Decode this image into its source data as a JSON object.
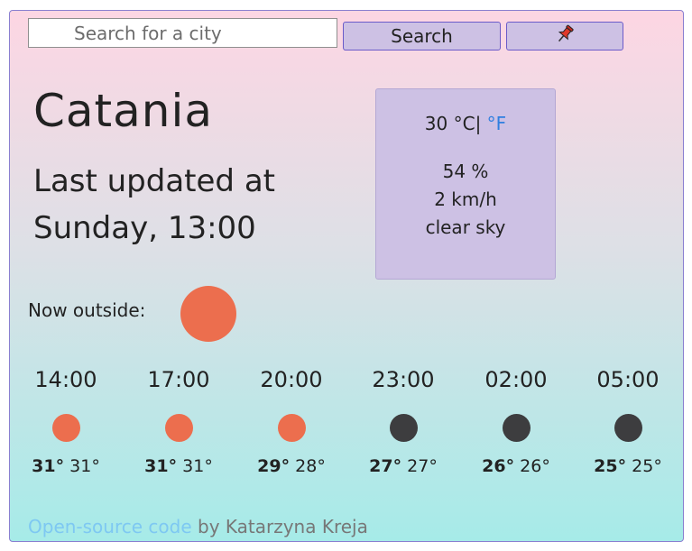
{
  "search": {
    "placeholder": "Search for a city",
    "button_label": "Search"
  },
  "location_button": {
    "icon": "pin-icon"
  },
  "current": {
    "city": "Catania",
    "updated_line1": "Last updated at",
    "updated_line2": "Sunday, 13:00",
    "temp_c": "30 °C",
    "unit_sep": "|",
    "unit_f": " °F",
    "humidity": "54 %",
    "wind": "2 km/h",
    "description": "clear sky",
    "now_label": "Now outside:",
    "now_icon": "sun-icon"
  },
  "forecast": [
    {
      "time": "14:00",
      "max": "31°",
      "min": "31°",
      "icon": "sun-icon",
      "color": "#ec6e4e"
    },
    {
      "time": "17:00",
      "max": "31°",
      "min": "31°",
      "icon": "sun-icon",
      "color": "#ec6e4e"
    },
    {
      "time": "20:00",
      "max": "29°",
      "min": "28°",
      "icon": "sun-icon",
      "color": "#ec6e4e"
    },
    {
      "time": "23:00",
      "max": "27°",
      "min": "27°",
      "icon": "moon-icon",
      "color": "#3d3d3f"
    },
    {
      "time": "02:00",
      "max": "26°",
      "min": "26°",
      "icon": "moon-icon",
      "color": "#3d3d3f"
    },
    {
      "time": "05:00",
      "max": "25°",
      "min": "25°",
      "icon": "moon-icon",
      "color": "#3d3d3f"
    }
  ],
  "footer": {
    "link_text": "Open-source code",
    "author_text": " by Katarzyna Kreja"
  },
  "colors": {
    "accent_sun": "#ec6e4e",
    "accent_night": "#3d3d3f",
    "button_bg": "#cdc1e4",
    "link": "#7ec8f2",
    "unit_link": "#2f7fe0"
  }
}
